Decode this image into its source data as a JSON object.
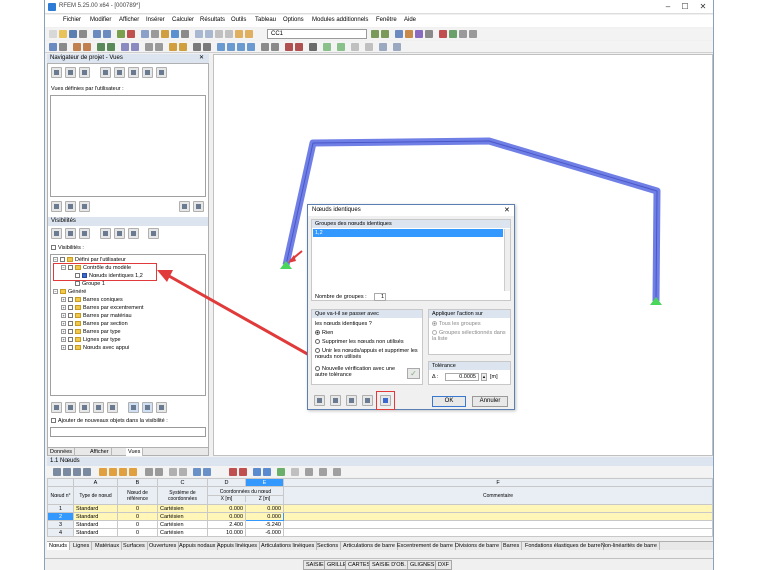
{
  "app": {
    "title": "RFEM 5.25.00 x64 - [000789*]",
    "window_controls": {
      "minimize": "–",
      "maximize": "☐",
      "close": "✕"
    }
  },
  "menu": [
    "Fichier",
    "Modifier",
    "Afficher",
    "Insérer",
    "Calculer",
    "Résultats",
    "Outils",
    "Tableau",
    "Options",
    "Modules additionnels",
    "Fenêtre",
    "Aide"
  ],
  "toolbar": {
    "load_case": "CC1"
  },
  "navigator": {
    "title": "Navigateur de projet - Vues",
    "views_label": "Vues définies par l'utilisateur :",
    "visibility_header": "Visibilités",
    "visibility_label": "Visibilités :",
    "tree": [
      {
        "label": "Défini par l'utilisateur",
        "level": 1,
        "type": "folder"
      },
      {
        "label": "Contrôle du modèle",
        "level": 2,
        "type": "folder"
      },
      {
        "label": "Nœuds identiques 1,2",
        "level": 3,
        "type": "item"
      },
      {
        "label": "Groupe 1",
        "level": 3,
        "type": "item"
      },
      {
        "label": "Généré",
        "level": 1,
        "type": "folder"
      },
      {
        "label": "Barres coniques",
        "level": 2,
        "type": "folder"
      },
      {
        "label": "Barres par excentrement",
        "level": 2,
        "type": "folder"
      },
      {
        "label": "Barres par matériau",
        "level": 2,
        "type": "folder"
      },
      {
        "label": "Barres par section",
        "level": 2,
        "type": "folder"
      },
      {
        "label": "Barres par type",
        "level": 2,
        "type": "folder"
      },
      {
        "label": "Lignes par type",
        "level": 2,
        "type": "folder"
      },
      {
        "label": "Nœuds avec appui",
        "level": 2,
        "type": "folder"
      }
    ],
    "add_new_label": "Ajouter de nouveaux objets dans la visibilité :",
    "tabs": [
      "Données",
      "Afficher",
      "Vues"
    ]
  },
  "dialog": {
    "title": "Nœuds identiques",
    "groups_header": "Groupes des nœuds identiques",
    "groups": [
      "1,2"
    ],
    "group_count_label": "Nombre de groupes :",
    "group_count": "1",
    "what_header": "Que va-t-il se passer avec",
    "what_sub": "les nœuds identiques ?",
    "options": [
      "Rien",
      "Supprimer les nœuds non utilisés",
      "Unir les nœuds/appuis et supprimer les nœuds non utilisés",
      "Nouvelle vérification avec une autre tolérance"
    ],
    "apply_header": "Appliquer l'action sur",
    "apply_options": [
      "Tous les groupes",
      "Groupes sélectionnés dans la liste"
    ],
    "tolerance_header": "Tolérance",
    "tolerance_symbol": "Δ :",
    "tolerance_value": "0.0005",
    "tolerance_unit": "[m]",
    "ok": "OK",
    "cancel": "Annuler"
  },
  "table": {
    "title": "1.1 Nœuds",
    "col_letters": [
      "A",
      "B",
      "C",
      "D",
      "E",
      "F"
    ],
    "headers": {
      "node": "Nœud n°",
      "type": "Type de nœud",
      "ref": "Nœud de référence",
      "coord": "Système de coordonnées",
      "coords_group": "Coordonnées du nœud",
      "x": "X [m]",
      "z": "Z [m]",
      "comment": "Commentaire"
    },
    "rows": [
      {
        "no": "1",
        "type": "Standard",
        "ref": "0",
        "sys": "Cartésien",
        "x": "0.000",
        "z": "0.000"
      },
      {
        "no": "2",
        "type": "Standard",
        "ref": "0",
        "sys": "Cartésien",
        "x": "0.000",
        "z": "0.000"
      },
      {
        "no": "3",
        "type": "Standard",
        "ref": "0",
        "sys": "Cartésien",
        "x": "2.400",
        "z": "-5.240"
      },
      {
        "no": "4",
        "type": "Standard",
        "ref": "0",
        "sys": "Cartésien",
        "x": "10.000",
        "z": "-6.000"
      }
    ],
    "tabs": [
      "Nœuds",
      "Lignes",
      "Matériaux",
      "Surfaces",
      "Ouvertures",
      "Appuis nodaux",
      "Appuis linéiques",
      "Articulations linéiques",
      "Sections",
      "Articulations de barre",
      "Excentrement de barre",
      "Divisions de barre",
      "Barres",
      "Fondations élastiques de barre",
      "Non-linéarités de barre"
    ]
  },
  "statusbar": [
    "SAISIE",
    "GRILLE",
    "CARTES",
    "SAISIE D'OB.",
    "GLIGNES",
    "DXF"
  ],
  "colors": {
    "frame": "#6f7fe6",
    "support": "#49d65a",
    "highlight": "#e03a3a",
    "selection": "#3399ff",
    "row_highlight": "#fff6b8"
  }
}
